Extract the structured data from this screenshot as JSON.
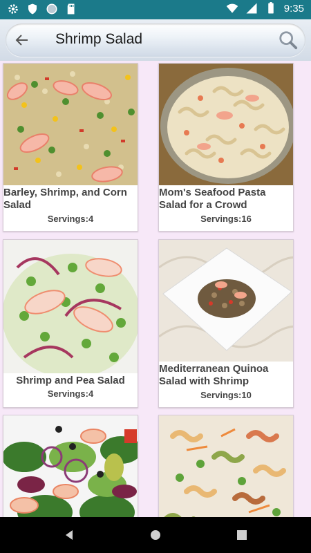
{
  "status_bar": {
    "time": "9:35"
  },
  "search": {
    "query": "Shrimp Salad"
  },
  "recipes": [
    {
      "title": "Barley, Shrimp, and Corn Salad",
      "servings": "Servings:4"
    },
    {
      "title": "Mom's Seafood Pasta Salad for a Crowd",
      "servings": "Servings:16"
    },
    {
      "title": "Shrimp and Pea Salad",
      "servings": "Servings:4"
    },
    {
      "title": "Mediterranean Quinoa Salad with Shrimp",
      "servings": "Servings:10"
    },
    {
      "title": "",
      "servings": ""
    },
    {
      "title": "",
      "servings": ""
    }
  ],
  "colors": {
    "status_bar": "#1b7a8a",
    "background": "#f7e8f8",
    "nav_bar": "#000000"
  }
}
